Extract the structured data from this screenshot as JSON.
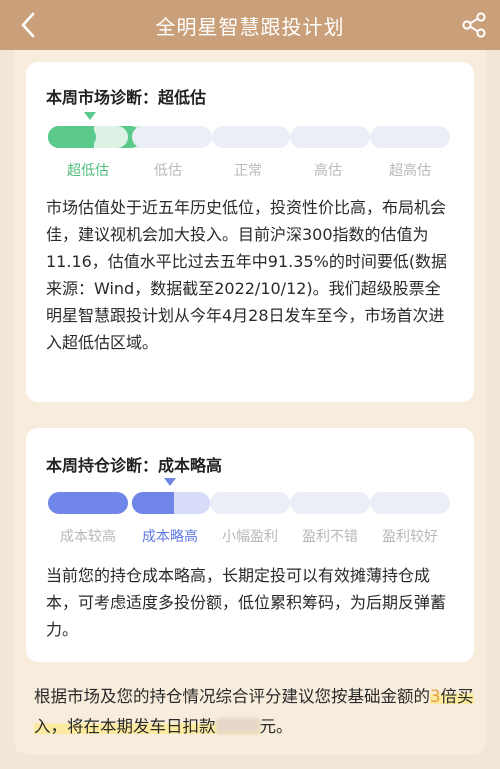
{
  "header": {
    "title": "全明星智慧跟投计划",
    "back_icon": "chevron-left-icon",
    "share_icon": "share-icon"
  },
  "colors": {
    "header_bg": "#c9a07a",
    "market_active": "#5bc98a",
    "market_light": "#dcf3e6",
    "position_active": "#6f86e8",
    "position_light": "#d7ddf8",
    "inactive_seg": "#ebeef6",
    "accent": "#e8a23c"
  },
  "market": {
    "title": "本周市场诊断：超低估",
    "levels": [
      "超低估",
      "低估",
      "正常",
      "高估",
      "超高估"
    ],
    "active_level": "超低估",
    "body": "市场估值处于近五年历史低位，投资性价比高，布局机会佳，建议视机会加大投入。目前沪深300指数的估值为11.16，估值水平比过去五年中91.35%的时间要低(数据来源：Wind，数据截至2022/10/12)。我们超级股票全明星智慧跟投计划从今年4月28日发车至今，市场首次进入超低估区域。"
  },
  "position": {
    "title": "本周持仓诊断：成本略高",
    "levels": [
      "成本较高",
      "成本略高",
      "小幅盈利",
      "盈利不错",
      "盈利较好"
    ],
    "active_level": "成本略高",
    "body": "当前您的持仓成本略高，长期定投可以有效摊薄持仓成本，可考虑适度多投份额，低位累积筹码，为后期反弹蓄力。"
  },
  "summary": {
    "line1": "根据市场及您的持仓情况综合评分建议您按基础金额的",
    "multiplier": "3",
    "line2": "倍买入，将在本期发车日扣款",
    "line3": "元。"
  }
}
